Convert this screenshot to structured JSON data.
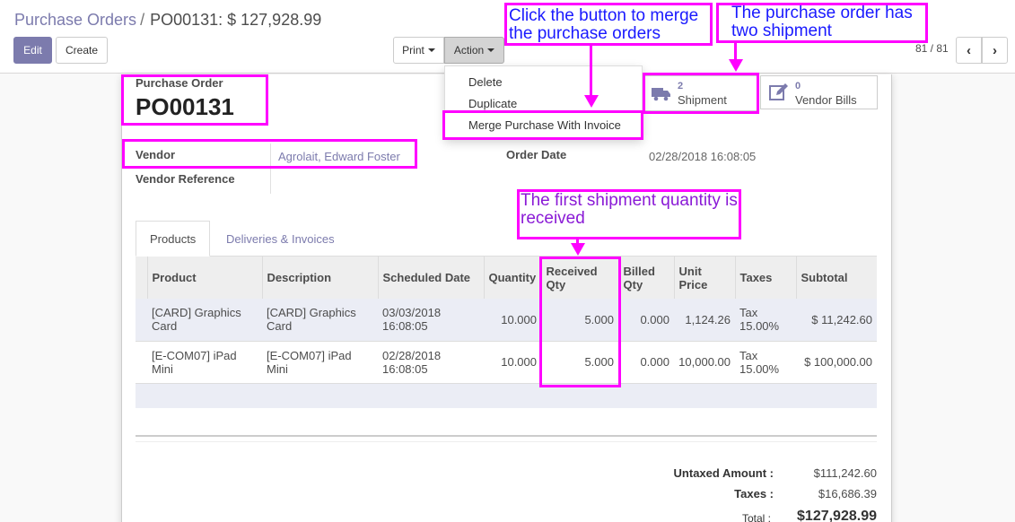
{
  "breadcrumb": {
    "parent": "Purchase Orders",
    "separator": "/",
    "current": "PO00131: $ 127,928.99"
  },
  "buttons": {
    "edit": "Edit",
    "create": "Create",
    "print": "Print",
    "action": "Action"
  },
  "pager": {
    "value": "81 / 81",
    "prev": "‹",
    "next": "›"
  },
  "action_menu": {
    "items": [
      "Delete",
      "Duplicate",
      "Merge Purchase With Invoice"
    ]
  },
  "smart_buttons": {
    "shipment": {
      "count": "2",
      "label": "Shipment"
    },
    "bills": {
      "count": "0",
      "label": "Vendor Bills"
    }
  },
  "form": {
    "title_label": "Purchase Order",
    "name": "PO00131",
    "vendor_label": "Vendor",
    "vendor_value": "Agrolait, Edward Foster",
    "vendor_ref_label": "Vendor Reference",
    "order_date_label": "Order Date",
    "order_date_value": "02/28/2018 16:08:05"
  },
  "tabs": [
    "Products",
    "Deliveries & Invoices"
  ],
  "table": {
    "headers": [
      "Product",
      "Description",
      "Scheduled Date",
      "Quantity",
      "Received Qty",
      "Billed Qty",
      "Unit Price",
      "Taxes",
      "Subtotal"
    ],
    "rows": [
      {
        "product": "[CARD] Graphics Card",
        "description": "[CARD] Graphics Card",
        "date": "03/03/2018 16:08:05",
        "quantity": "10.000",
        "received": "5.000",
        "billed": "0.000",
        "unit_price": "1,124.26",
        "taxes": "Tax 15.00%",
        "subtotal": "$ 11,242.60"
      },
      {
        "product": "[E-COM07] iPad Mini",
        "description": "[E-COM07] iPad Mini",
        "date": "02/28/2018 16:08:05",
        "quantity": "10.000",
        "received": "5.000",
        "billed": "0.000",
        "unit_price": "10,000.00",
        "taxes": "Tax 15.00%",
        "subtotal": "$ 100,000.00"
      }
    ]
  },
  "totals": {
    "untaxed_label": "Untaxed Amount :",
    "untaxed_value": "$111,242.60",
    "taxes_label": "Taxes :",
    "taxes_value": "$16,686.39",
    "total_label": "Total :",
    "total_value": "$127,928.99"
  },
  "annotations": {
    "merge": "Click the button to merge the purchase orders",
    "shipment": "The purchase order has two shipment",
    "received": "The first shipment quantity is received"
  },
  "colors": {
    "accent": "#7c7bad",
    "highlight": "#ff00ff",
    "annotation_text": "#1a1aff"
  }
}
